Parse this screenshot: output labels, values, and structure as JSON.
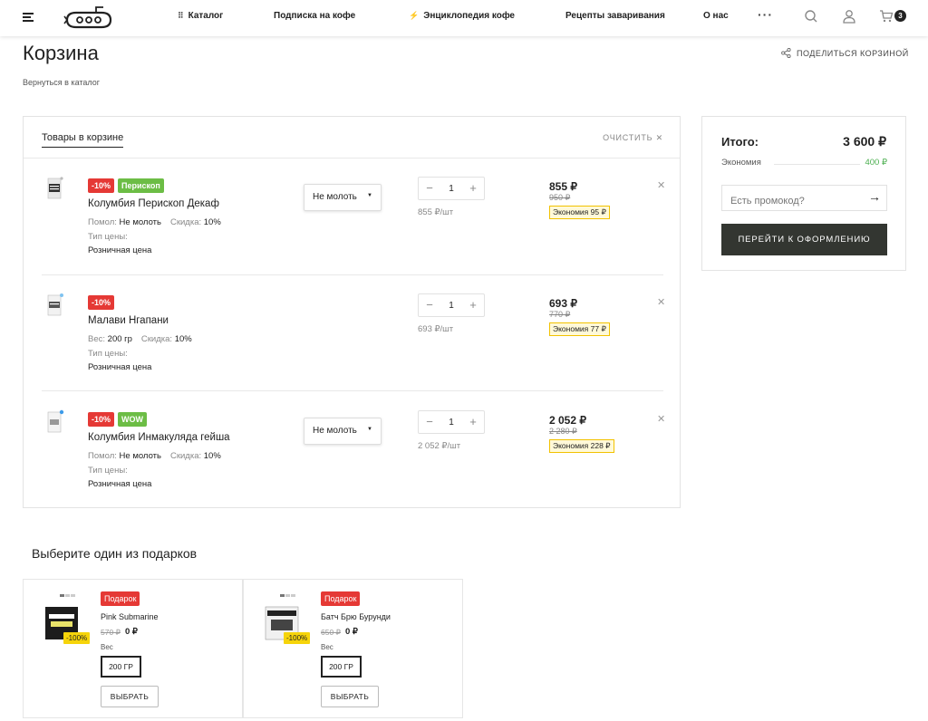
{
  "header": {
    "nav": [
      {
        "label": "Каталог",
        "icon": "grid-icon"
      },
      {
        "label": "Подписка на кофе"
      },
      {
        "label": "Энциклопедия кофе",
        "icon": "lightning-icon"
      },
      {
        "label": "Рецепты заваривания"
      },
      {
        "label": "О нас"
      }
    ],
    "more": "···",
    "cart_count": "3"
  },
  "page": {
    "title": "Корзина",
    "share": "ПОДЕЛИТЬСЯ КОРЗИНОЙ",
    "back": "Вернуться в каталог"
  },
  "cart": {
    "tab": "Товары в корзине",
    "clear": "ОЧИСТИТЬ",
    "clear_icon": "close-icon",
    "items": [
      {
        "badges": [
          {
            "text": "-10%",
            "color": "red"
          },
          {
            "text": "Перископ",
            "color": "green"
          }
        ],
        "name": "Колумбия Перископ Декаф",
        "prop1_label": "Помол:",
        "prop1_value": "Не молоть",
        "prop2_label": "Скидка:",
        "prop2_value": "10%",
        "price_type_label": "Тип цены:",
        "price_type": "Розничная цена",
        "grind": "Не молоть",
        "qty": "1",
        "per_unit": "855 ₽/шт",
        "price": "855 ₽",
        "old_price": "950 ₽",
        "economy": "Экономия  95 ₽"
      },
      {
        "badges": [
          {
            "text": "-10%",
            "color": "red"
          }
        ],
        "name": "Малави Нгапани",
        "prop1_label": "Вес:",
        "prop1_value": "200 гр",
        "prop2_label": "Скидка:",
        "prop2_value": "10%",
        "price_type_label": "Тип цены:",
        "price_type": "Розничная цена",
        "grind": "",
        "qty": "1",
        "per_unit": "693 ₽/шт",
        "price": "693 ₽",
        "old_price": "770 ₽",
        "economy": "Экономия  77 ₽"
      },
      {
        "badges": [
          {
            "text": "-10%",
            "color": "red"
          },
          {
            "text": "WOW",
            "color": "green"
          }
        ],
        "name": "Колумбия Инмакуляда гейша",
        "prop1_label": "Помол:",
        "prop1_value": "Не молоть",
        "prop2_label": "Скидка:",
        "prop2_value": "10%",
        "price_type_label": "Тип цены:",
        "price_type": "Розничная цена",
        "grind": "Не молоть",
        "qty": "1",
        "per_unit": "2 052 ₽/шт",
        "price": "2 052 ₽",
        "old_price": "2 280 ₽",
        "economy": "Экономия  228 ₽"
      }
    ]
  },
  "summary": {
    "total_label": "Итого:",
    "total": "3 600 ₽",
    "economy_label": "Экономия",
    "economy": "400 ₽",
    "promo_placeholder": "Есть промокод?",
    "checkout": "ПЕРЕЙТИ К ОФОРМЛЕНИЮ"
  },
  "gifts": {
    "title": "Выберите один из подарков",
    "items": [
      {
        "badge": "Подарок",
        "name": "Pink Submarine",
        "old_price": "570 ₽",
        "price": "0 ₽",
        "discount": "-100%",
        "weight_label": "Вес",
        "weight": "200 ГР",
        "select": "ВЫБРАТЬ"
      },
      {
        "badge": "Подарок",
        "name": "Батч Брю Бурунди",
        "old_price": "650 ₽",
        "price": "0 ₽",
        "discount": "-100%",
        "weight_label": "Вес",
        "weight": "200 ГР",
        "select": "ВЫБРАТЬ"
      }
    ]
  },
  "colors": {
    "accent_dark": "#333631",
    "sale_red": "#e53935",
    "badge_green": "#6cbd45",
    "economy_green": "#4caf50",
    "economy_yellow": "#f2c200"
  }
}
